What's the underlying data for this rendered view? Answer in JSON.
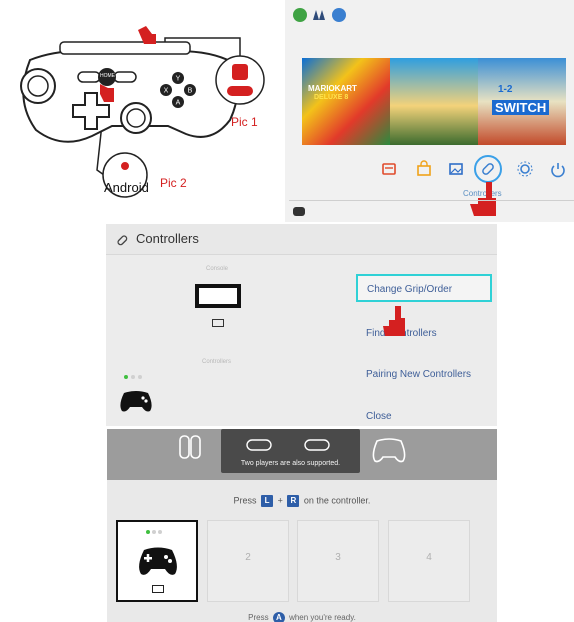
{
  "diagram": {
    "pic1_label": "Pic 1",
    "pic2_label": "Pic 2",
    "android_label": "Android",
    "home_button_label": "HOME",
    "face_buttons": [
      "Y",
      "X",
      "B",
      "A"
    ]
  },
  "home_screen": {
    "game_tiles": [
      {
        "title": "MARIOKART",
        "subtitle": "DELUXE 8"
      },
      {
        "title": "",
        "subtitle": ""
      },
      {
        "title": "SWITCH",
        "subtitle": "1-2"
      }
    ],
    "controllers_caption": "Controllers",
    "icons": [
      "news-icon",
      "eshop-icon",
      "album-icon",
      "controllers-icon",
      "settings-icon",
      "power-icon"
    ]
  },
  "controllers_menu": {
    "title": "Controllers",
    "console_label": "Console",
    "controllers_label": "Controllers",
    "items": [
      "Change Grip/Order",
      "Find Controllers",
      "Pairing New Controllers",
      "Close"
    ]
  },
  "grip_screen": {
    "tooltip": "Two players are also supported.",
    "press_prefix": "Press",
    "key_l": "L",
    "key_plus": "+",
    "key_r": "R",
    "press_suffix": "on the controller.",
    "slots": [
      "2",
      "3",
      "4"
    ],
    "ready_prefix": "Press",
    "key_a": "A",
    "ready_suffix": "when you're ready."
  },
  "colors": {
    "accent_red": "#d42020",
    "selection_cyan": "#2fd1d6",
    "menu_text_blue": "#3e5e98",
    "button_blue": "#2e5ea8"
  }
}
